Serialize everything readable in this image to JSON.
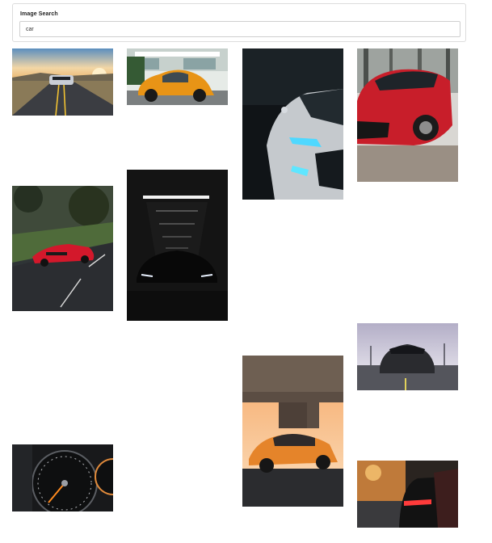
{
  "search": {
    "label": "Image Search",
    "value": "car"
  },
  "results": [
    "sports-car-on-curved-road",
    "orange-beetle-street",
    "white-audi-headlight",
    "red-hatchback-front",
    "red-audi-tt-road",
    "dark-car-garage-lights",
    "mustang-on-runway",
    "orange-audi-under-bridge",
    "speedometer-gauge",
    "red-taillights-street"
  ]
}
